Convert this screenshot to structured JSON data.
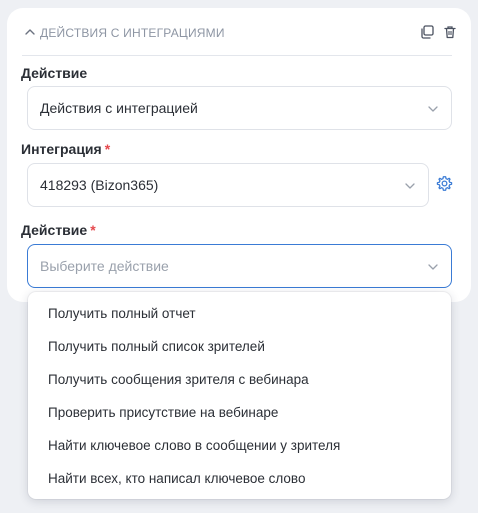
{
  "section": {
    "title": "ДЕЙСТВИЯ С ИНТЕГРАЦИЯМИ",
    "icons": [
      "chevron-up-icon",
      "copy-icon",
      "trash-icon"
    ]
  },
  "fields": {
    "action_type": {
      "label": "Действие",
      "value": "Действия с интеграцией"
    },
    "integration": {
      "label": "Интеграция",
      "required_mark": "*",
      "value": "418293 (Bizon365)"
    },
    "action": {
      "label": "Действие",
      "required_mark": "*",
      "placeholder": "Выберите действие"
    }
  },
  "dropdown": {
    "options": [
      "Получить полный отчет",
      "Получить полный список зрителей",
      "Получить сообщения зрителя с вебинара",
      "Проверить присутствие на вебинаре",
      "Найти ключевое слово в сообщении у зрителя",
      "Найти всех, кто написал ключевое слово"
    ]
  },
  "colors": {
    "accent": "#3a7bd5",
    "required": "#e5484d",
    "background": "#eef0f4"
  }
}
